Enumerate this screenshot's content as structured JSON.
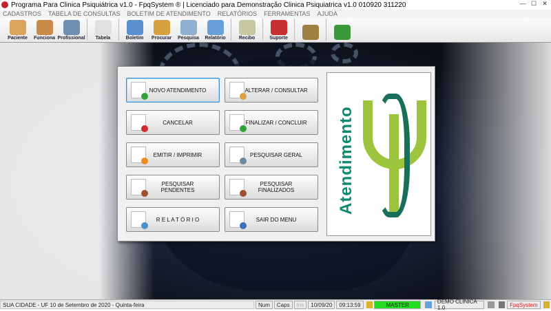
{
  "window": {
    "title": "Programa Para Clinica Psiquiátrica v1.0 - FpqSystem ® | Licenciado para  Demonstração Clinica Psiquiatrica v1.0 010920 311220"
  },
  "menu": [
    "CADASTROS",
    "TABELA DE CONSULTAS",
    "BOLETIM DE ATENDIMENTO",
    "RELATÓRIOS",
    "FERRAMENTAS",
    "AJUDA"
  ],
  "toolbar": [
    {
      "label": "Paciente",
      "color": "#d9a45c"
    },
    {
      "label": "Funciona",
      "color": "#c98a4a"
    },
    {
      "label": "Profissional",
      "color": "#6f8fb0"
    },
    {
      "label": "Tabela",
      "color": "#e0e0e0"
    },
    {
      "label": "Boletim",
      "color": "#5a8fd0"
    },
    {
      "label": "Procurar",
      "color": "#d9a040"
    },
    {
      "label": "Pesquisa",
      "color": "#8fb0d0"
    },
    {
      "label": "Relatório",
      "color": "#6aa0d8"
    },
    {
      "label": "Recibo",
      "color": "#c8c8a0"
    },
    {
      "label": "Suporte",
      "color": "#c83030"
    },
    {
      "label": "",
      "color": "#a08040"
    },
    {
      "label": "",
      "color": "#3a9a3a"
    }
  ],
  "panel": {
    "buttons": [
      {
        "label": "NOVO ATENDIMENTO",
        "icon": "new-document-icon",
        "color": "#2fa33a"
      },
      {
        "label": "ALTERAR  /  CONSULTAR",
        "icon": "edit-pencil-icon",
        "color": "#d9a040"
      },
      {
        "label": "CANCELAR",
        "icon": "cancel-document-icon",
        "color": "#d02a2a"
      },
      {
        "label": "FINALIZAR  /  CONCLUIR",
        "icon": "check-document-icon",
        "color": "#2fa33a"
      },
      {
        "label": "EMITIR  /  IMPRIMIR",
        "icon": "print-person-icon",
        "color": "#f08a20"
      },
      {
        "label": "PESQUISAR GERAL",
        "icon": "search-tools-icon",
        "color": "#6a8aa0"
      },
      {
        "label": "PESQUISAR PENDENTES",
        "icon": "search-pending-icon",
        "color": "#a05030"
      },
      {
        "label": "PESQUISAR FINALIZADOS",
        "icon": "search-finished-icon",
        "color": "#a05030"
      },
      {
        "label": "R E L A T Ó R I O",
        "icon": "report-printer-icon",
        "color": "#4a90d0"
      },
      {
        "label": "SAIR DO MENU",
        "icon": "exit-icon",
        "color": "#3a70c0"
      }
    ],
    "logo_text": "Atendimento"
  },
  "status": {
    "city": "SUA CIDADE - UF 10 de Setembro de 2020 - Quinta-feira",
    "num": "Num",
    "caps": "Caps",
    "ins": "Ins",
    "date": "10/09/20",
    "time": "09:13:59",
    "user": "MASTER",
    "company": "DEMO CLINICA 1.0",
    "brand": "FpqSystem"
  }
}
